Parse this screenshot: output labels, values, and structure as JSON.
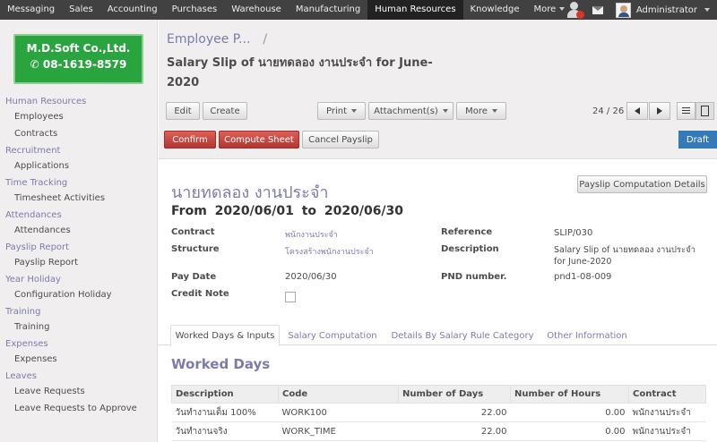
{
  "topnav": {
    "items": [
      "Messaging",
      "Sales",
      "Accounting",
      "Purchases",
      "Warehouse",
      "Manufacturing",
      "Human Resources",
      "Knowledge",
      "More"
    ],
    "active": "Human Resources",
    "username": "Administrator"
  },
  "logo": {
    "company": "M.D.Soft Co.,Ltd.",
    "phone": "08-1619-8579"
  },
  "sidebar": {
    "sections": [
      {
        "title": "Human Resources",
        "items": [
          "Employees",
          "Contracts"
        ]
      },
      {
        "title": "Recruitment",
        "items": [
          "Applications"
        ]
      },
      {
        "title": "Time Tracking",
        "items": [
          "Timesheet Activities"
        ]
      },
      {
        "title": "Attendances",
        "items": [
          "Attendances"
        ]
      },
      {
        "title": "Payslip Report",
        "items": [
          "Payslip Report"
        ]
      },
      {
        "title": "Year Holiday",
        "items": [
          "Configuration Holiday"
        ]
      },
      {
        "title": "Training",
        "items": [
          "Training"
        ]
      },
      {
        "title": "Expenses",
        "items": [
          "Expenses"
        ]
      },
      {
        "title": "Leaves",
        "items": [
          "Leave Requests",
          "Leave Requests to Approve"
        ]
      }
    ]
  },
  "header": {
    "breadcrumb": "Employee P...",
    "breadcrumb_sep": "/",
    "title": "Salary Slip of นายทดลอง งานประจำ for June-2020"
  },
  "toolbar": {
    "edit": "Edit",
    "create": "Create",
    "print": "Print",
    "attachments": "Attachment(s)",
    "more": "More",
    "pager": "24 / 26"
  },
  "status": {
    "confirm": "Confirm",
    "compute": "Compute Sheet",
    "cancel": "Cancel Payslip",
    "state": "Draft"
  },
  "form": {
    "details_button": "Payslip Computation Details",
    "employee": "นายทดลอง งานประจำ",
    "from_label": "From",
    "date_from": "2020/06/01",
    "to_label": "to",
    "date_to": "2020/06/30",
    "contract_label": "Contract",
    "contract": "พนักงานประจำ",
    "structure_label": "Structure",
    "structure": "โครงสร้างพนักงานประจำ",
    "pay_date_label": "Pay Date",
    "pay_date": "2020/06/30",
    "credit_note_label": "Credit Note",
    "credit_note": false,
    "reference_label": "Reference",
    "reference": "SLIP/030",
    "description_label": "Description",
    "description": "Salary Slip of นายทดลอง งานประจำ for June-2020",
    "pnd_label": "PND number.",
    "pnd": "pnd1-08-009"
  },
  "tabs": [
    "Worked Days & Inputs",
    "Salary Computation",
    "Details By Salary Rule Category",
    "Other Information"
  ],
  "worked_days": {
    "title": "Worked Days",
    "columns": [
      "Description",
      "Code",
      "Number of Days",
      "Number of Hours",
      "Contract"
    ],
    "rows": [
      [
        "วันทำงานเต็ม 100%",
        "WORK100",
        "22.00",
        "0.00",
        "พนักงานประจำ"
      ],
      [
        "วันทำงานจริง",
        "WORK_TIME",
        "22.00",
        "0.00",
        "พนักงานประจำ"
      ]
    ]
  }
}
